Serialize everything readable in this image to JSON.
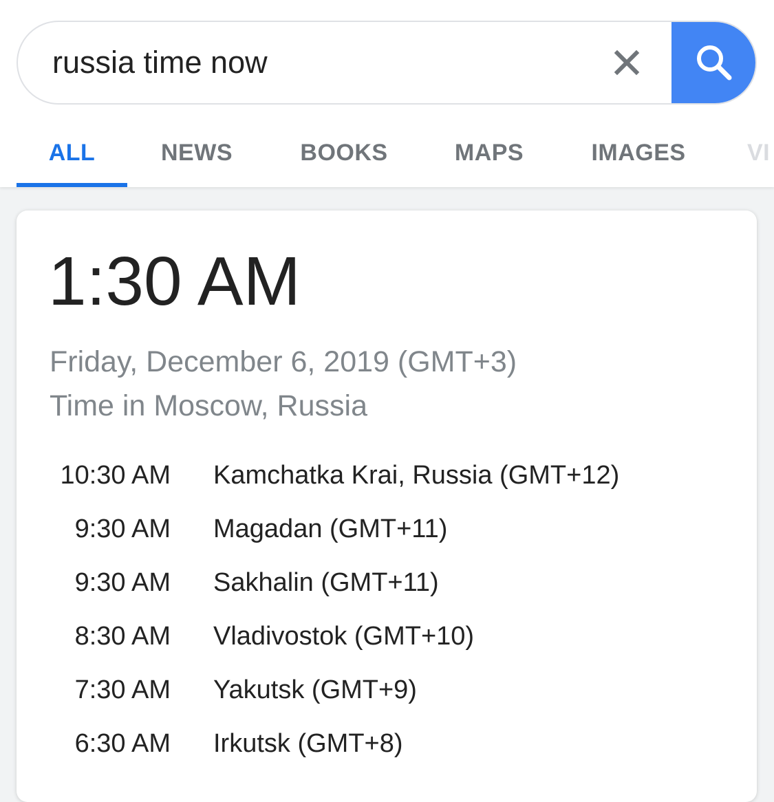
{
  "search": {
    "query": "russia time now"
  },
  "tabs": [
    {
      "label": "ALL"
    },
    {
      "label": "NEWS"
    },
    {
      "label": "BOOKS"
    },
    {
      "label": "MAPS"
    },
    {
      "label": "IMAGES"
    },
    {
      "label": "VI"
    }
  ],
  "clock": {
    "time": "1:30 AM",
    "date": "Friday, December 6, 2019 (GMT+3)",
    "location": "Time in Moscow, Russia"
  },
  "zones": [
    {
      "time": "10:30 AM",
      "name": "Kamchatka Krai, Russia (GMT+12)"
    },
    {
      "time": "9:30 AM",
      "name": "Magadan (GMT+11)"
    },
    {
      "time": "9:30 AM",
      "name": "Sakhalin (GMT+11)"
    },
    {
      "time": "8:30 AM",
      "name": "Vladivostok (GMT+10)"
    },
    {
      "time": "7:30 AM",
      "name": "Yakutsk (GMT+9)"
    },
    {
      "time": "6:30 AM",
      "name": "Irkutsk (GMT+8)"
    }
  ],
  "colors": {
    "accent": "#1a73e8",
    "search_button": "#4285f4",
    "muted_text": "#80868b"
  },
  "icons": {
    "clear": "close-icon",
    "search": "search-icon"
  }
}
